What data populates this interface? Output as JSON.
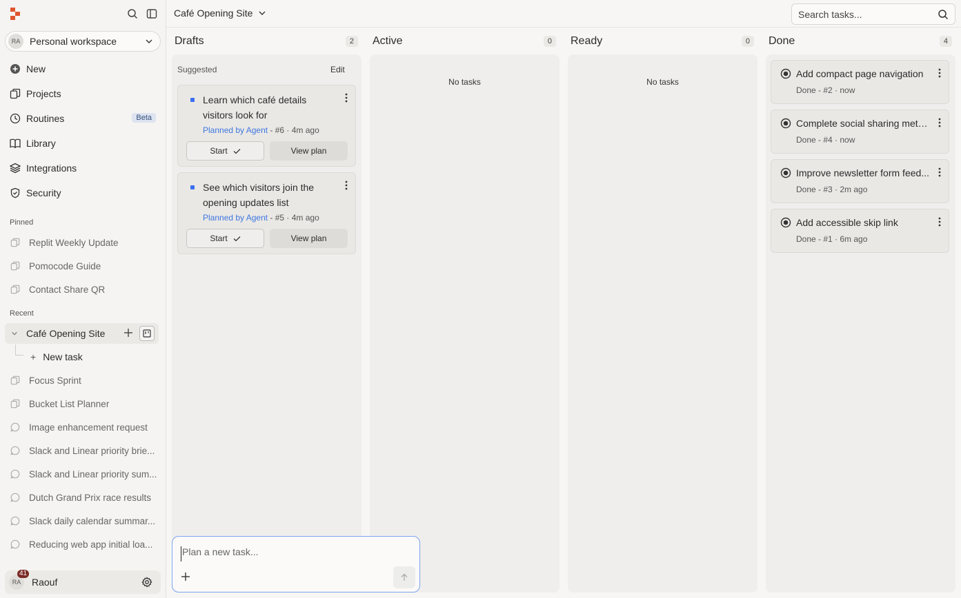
{
  "sidebar": {
    "workspace": {
      "avatar": "RA",
      "name": "Personal workspace"
    },
    "nav": [
      {
        "label": "New",
        "icon": "plus-circle-icon"
      },
      {
        "label": "Projects",
        "icon": "projects-icon"
      },
      {
        "label": "Routines",
        "icon": "clock-icon",
        "badge": "Beta"
      },
      {
        "label": "Library",
        "icon": "book-icon"
      },
      {
        "label": "Integrations",
        "icon": "layers-icon"
      },
      {
        "label": "Security",
        "icon": "shield-icon"
      }
    ],
    "pinned_label": "Pinned",
    "pinned": [
      {
        "label": "Replit Weekly Update"
      },
      {
        "label": "Pomocode Guide"
      },
      {
        "label": "Contact Share QR"
      }
    ],
    "recent_label": "Recent",
    "recent_active": {
      "label": "Café Opening Site",
      "child": "New task"
    },
    "recent": [
      {
        "label": "Focus Sprint",
        "icon": "project-icon"
      },
      {
        "label": "Bucket List Planner",
        "icon": "project-icon"
      },
      {
        "label": "Image enhancement request",
        "icon": "chat-icon"
      },
      {
        "label": "Slack and Linear priority brie...",
        "icon": "chat-icon"
      },
      {
        "label": "Slack and Linear priority sum...",
        "icon": "chat-icon"
      },
      {
        "label": "Dutch Grand Prix race results",
        "icon": "chat-icon"
      },
      {
        "label": "Slack daily calendar summar...",
        "icon": "chat-icon"
      },
      {
        "label": "Reducing web app initial loa...",
        "icon": "chat-icon"
      }
    ],
    "user": {
      "avatar": "RA",
      "name": "Raouf",
      "notifications": "41"
    }
  },
  "header": {
    "project_title": "Café Opening Site",
    "search_placeholder": "Search tasks..."
  },
  "columns": {
    "drafts": {
      "title": "Drafts",
      "count": "2",
      "suggested": "Suggested",
      "edit": "Edit"
    },
    "active": {
      "title": "Active",
      "count": "0",
      "empty": "No tasks"
    },
    "ready": {
      "title": "Ready",
      "count": "0",
      "empty": "No tasks"
    },
    "done": {
      "title": "Done",
      "count": "4"
    }
  },
  "drafts": [
    {
      "title": "Learn which café details visitors look for",
      "agent": "Planned by Agent",
      "meta": " - #6 · 4m ago",
      "start": "Start",
      "view": "View plan"
    },
    {
      "title": "See which visitors join the opening updates list",
      "agent": "Planned by Agent",
      "meta": " - #5 · 4m ago",
      "start": "Start",
      "view": "View plan"
    }
  ],
  "done": [
    {
      "title": "Add compact page navigation",
      "meta": "Done - #2 · now"
    },
    {
      "title": "Complete social sharing meta...",
      "meta": "Done - #4 · now"
    },
    {
      "title": "Improve newsletter form feed...",
      "meta": "Done - #3 · 2m ago"
    },
    {
      "title": "Add accessible skip link",
      "meta": "Done - #1 · 6m ago"
    }
  ],
  "composer": {
    "placeholder": "Plan a new task..."
  },
  "colors": {
    "accent": "#3b6ff0",
    "agent_link": "#3f76e0",
    "logo": "#e0552f"
  }
}
